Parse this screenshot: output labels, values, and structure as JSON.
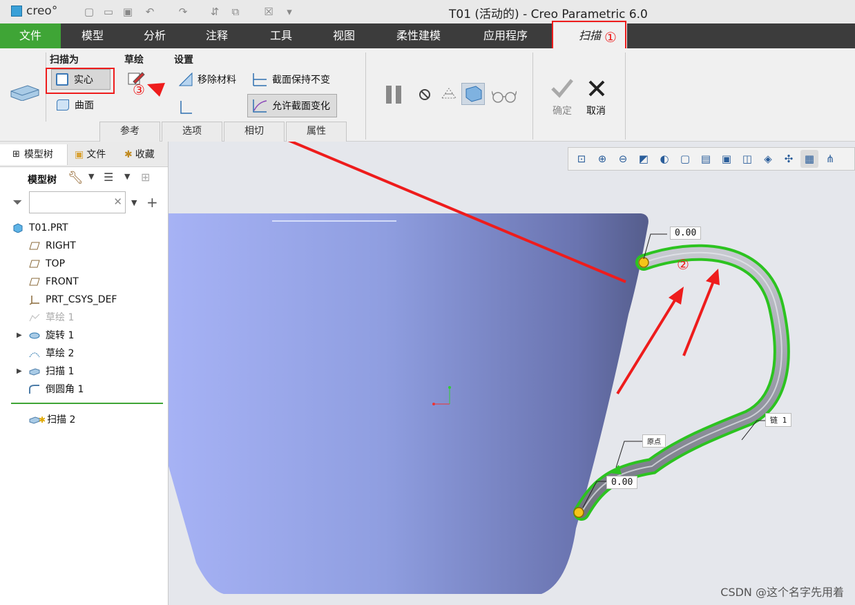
{
  "app": {
    "logo_text": "creo°",
    "window_title": "T01 (活动的) - Creo Parametric 6.0"
  },
  "menu": {
    "tabs": [
      "文件",
      "模型",
      "分析",
      "注释",
      "工具",
      "视图",
      "柔性建模",
      "应用程序",
      "扫描"
    ]
  },
  "ribbon": {
    "sweep_as": {
      "title": "扫描为",
      "solid": "实心",
      "surface": "曲面"
    },
    "sketch": {
      "title": "草绘"
    },
    "settings": {
      "title": "设置",
      "remove_material": "移除材料",
      "keep_section": "截面保持不变",
      "allow_variable": "允许截面变化"
    },
    "ok": "确定",
    "cancel": "取消",
    "bottom_tabs": [
      "参考",
      "选项",
      "相切",
      "属性"
    ]
  },
  "panel": {
    "tabs": [
      "模型树",
      "文件",
      "收藏"
    ],
    "header": "模型树",
    "search_placeholder": ""
  },
  "tree": {
    "items": [
      {
        "label": "T01.PRT",
        "icon": "part-icon"
      },
      {
        "label": "RIGHT",
        "icon": "datum-plane-icon"
      },
      {
        "label": "TOP",
        "icon": "datum-plane-icon"
      },
      {
        "label": "FRONT",
        "icon": "datum-plane-icon"
      },
      {
        "label": "PRT_CSYS_DEF",
        "icon": "csys-icon"
      },
      {
        "label": "草绘 1",
        "icon": "sketch-icon"
      },
      {
        "label": "旋转 1",
        "icon": "revolve-icon"
      },
      {
        "label": "草绘 2",
        "icon": "sketch-icon"
      },
      {
        "label": "扫描 1",
        "icon": "sweep-icon"
      },
      {
        "label": "倒圆角 1",
        "icon": "round-icon"
      },
      {
        "label": "扫描 2",
        "icon": "sweep-icon"
      }
    ]
  },
  "viewport": {
    "dim_top": "0.00",
    "dim_bottom": "0.00",
    "chain_label": "链 1",
    "origin_label": "原点"
  },
  "annotations": {
    "a1": "①",
    "a2": "②",
    "a3": "③"
  },
  "watermark": "CSDN @这个名字先用着",
  "colors": {
    "accent_green": "#3fa536",
    "annotation_red": "#ee1c1c",
    "cup_blue": "#8f9ee0"
  }
}
